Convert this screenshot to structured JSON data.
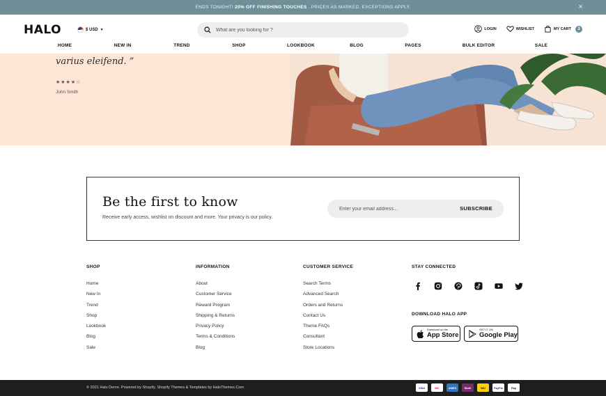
{
  "announcement": {
    "prefix": "ENDS TONIGHT!",
    "highlight": "20% OFF FINISHING TOUCHES",
    "suffix": ". PRICES AS MARKED. EXCEPTIONS APPLY.",
    "close": "×"
  },
  "header": {
    "logo": "HALO",
    "currency": "$ USD",
    "search_placeholder": "What are you looking for ?",
    "login": "LOGIN",
    "wishlist": "WISHLIST",
    "cart": "MY CART",
    "cart_count": "3"
  },
  "nav": [
    "HOME",
    "NEW IN",
    "TREND",
    "SHOP",
    "LOOKBOOK",
    "BLOG",
    "PAGES",
    "BULK EDITOR",
    "SALE"
  ],
  "hero": {
    "quote_line": "varius eleifend. ”",
    "rating_stars": 4,
    "rating_max": 5,
    "author": "John Smith"
  },
  "newsletter": {
    "title": "Be the first to know",
    "subtitle": "Receive early access, wishlist on discount and more. Your privacy is our policy.",
    "email_placeholder": "Enter your email address...",
    "button": "SUBSCRIBE"
  },
  "footer": {
    "shop": {
      "title": "SHOP",
      "links": [
        "Home",
        "New In",
        "Trend",
        "Shop",
        "Lookbook",
        "Blog",
        "Sale"
      ]
    },
    "information": {
      "title": "INFORMATION",
      "links": [
        "About",
        "Customer Service",
        "Reward Program",
        "Shipping & Returns",
        "Privacy Policy",
        "Terms & Conditions",
        "Blog"
      ]
    },
    "customer_service": {
      "title": "CUSTOMER SERVICE",
      "links": [
        "Search Terms",
        "Advanced Search",
        "Orders and Returns",
        "Contact Us",
        "Theme FAQs",
        "Consultant",
        "Store Locations"
      ]
    },
    "connected": {
      "title": "STAY CONNECTED",
      "social_icons": [
        "facebook-icon",
        "instagram-icon",
        "pinterest-icon",
        "tiktok-icon",
        "youtube-icon",
        "twitter-icon"
      ],
      "app_title": "DOWNLOAD HALO APP",
      "appstore_small": "Download on the",
      "appstore_big": "App Store",
      "gplay_small": "GET IT ON",
      "gplay_big": "Google Play"
    }
  },
  "bottom": {
    "copyright": "© 2021 Halo Demo. Powered by Shopify. Shopify Themes & Templates by HaloThemes.Com.",
    "payments": [
      "VISA",
      "MC",
      "AMEX",
      "Skrill",
      "WU",
      "PayPal",
      "Pay"
    ]
  },
  "colors": {
    "accent": "#6f8e97",
    "hero_bg": "#fde6d6",
    "bottom_bar": "#1e1e1e"
  }
}
